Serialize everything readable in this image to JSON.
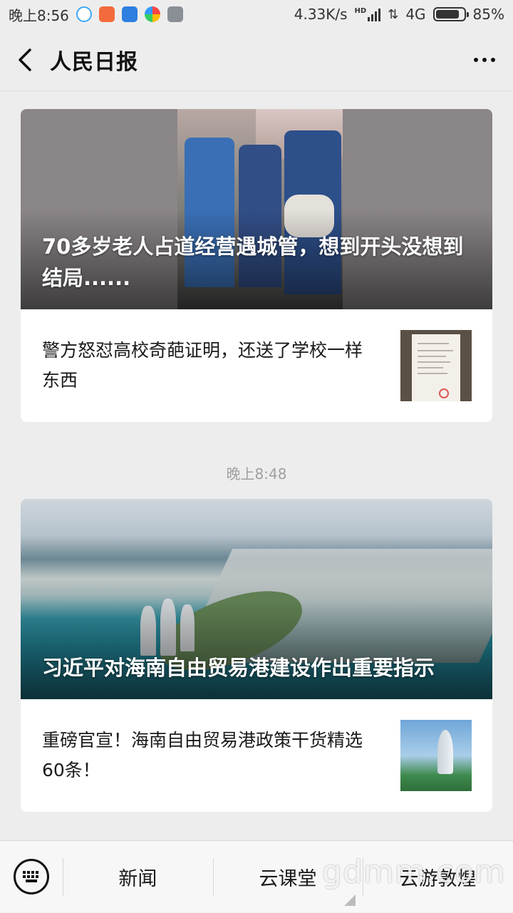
{
  "status_bar": {
    "time": "晚上8:56",
    "network_speed": "4.33K/s",
    "hd_label": "HD",
    "network_type": "4G",
    "battery_percent": "85%",
    "battery_level": 0.85,
    "notification_icons": [
      "qq-browser-icon",
      "taobao-icon",
      "hot-news-icon",
      "mobile-assistant-icon",
      "notes-icon"
    ]
  },
  "header": {
    "title": "人民日报"
  },
  "messages": [
    {
      "hero_title": "70多岁老人占道经营遇城管，想到开头没想到结局......",
      "sub_title": "警方怒怼高校奇葩证明，还送了学校一样东西"
    },
    {
      "hero_title": "习近平对海南自由贸易港建设作出重要指示",
      "sub_title": "重磅官宣！海南自由贸易港政策干货精选60条！"
    }
  ],
  "timestamp": "晚上8:48",
  "bottom_menu": {
    "items": [
      "新闻",
      "云课堂",
      "云游敦煌"
    ]
  },
  "watermark": "gdmm.com",
  "colors": {
    "background": "#ededed",
    "card": "#ffffff",
    "timestamp_text": "#a0a0a0"
  }
}
